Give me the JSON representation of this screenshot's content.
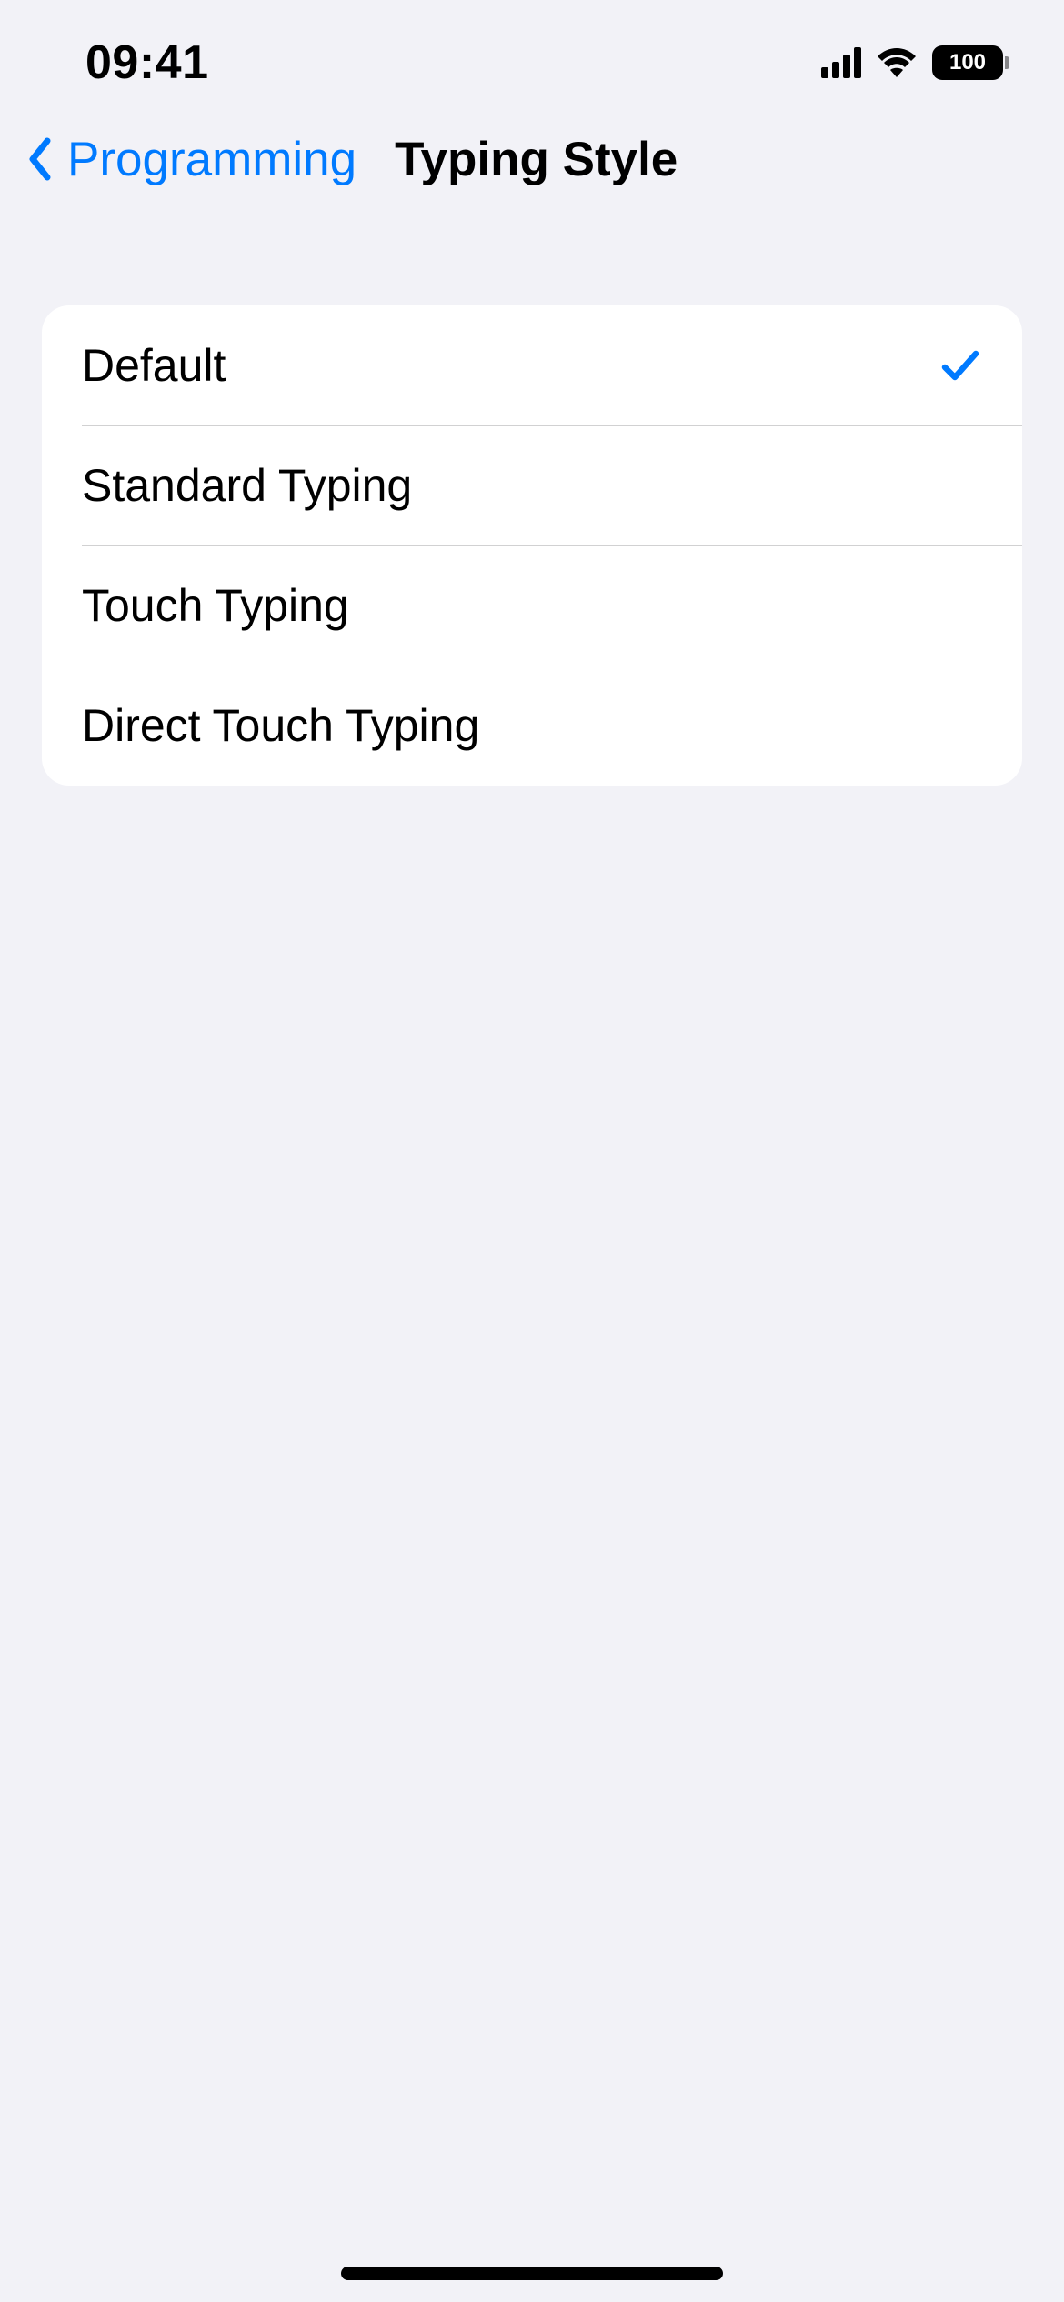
{
  "status_bar": {
    "time": "09:41",
    "battery": "100"
  },
  "nav": {
    "back_label": "Programming",
    "title": "Typing Style"
  },
  "options": [
    {
      "label": "Default",
      "selected": true
    },
    {
      "label": "Standard Typing",
      "selected": false
    },
    {
      "label": "Touch Typing",
      "selected": false
    },
    {
      "label": "Direct Touch Typing",
      "selected": false
    }
  ],
  "colors": {
    "accent": "#007aff",
    "background": "#f2f2f7",
    "row_bg": "#ffffff",
    "separator": "#c6c6c8"
  }
}
